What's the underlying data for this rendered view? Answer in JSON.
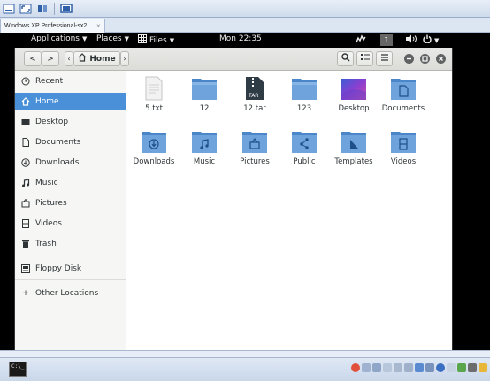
{
  "host": {
    "tab_title": "Windows XP Professional-sx2 ...",
    "tab_close": "×"
  },
  "topbar": {
    "applications": "Applications",
    "places": "Places",
    "files": "Files",
    "clock": "Mon 22:35",
    "workspace": "1"
  },
  "headerbar": {
    "back": "<",
    "forward": ">",
    "path_left": "‹",
    "path_home": "Home",
    "path_right": "›"
  },
  "sidebar": {
    "items": [
      {
        "label": "Recent",
        "icon": "clock-icon"
      },
      {
        "label": "Home",
        "icon": "home-icon",
        "active": true
      },
      {
        "label": "Desktop",
        "icon": "desktop-icon"
      },
      {
        "label": "Documents",
        "icon": "document-icon"
      },
      {
        "label": "Downloads",
        "icon": "download-icon"
      },
      {
        "label": "Music",
        "icon": "music-icon"
      },
      {
        "label": "Pictures",
        "icon": "pictures-icon"
      },
      {
        "label": "Videos",
        "icon": "video-icon"
      },
      {
        "label": "Trash",
        "icon": "trash-icon"
      },
      {
        "label": "Floppy Disk",
        "icon": "floppy-icon"
      },
      {
        "label": "Other Locations",
        "icon": "plus-icon"
      }
    ]
  },
  "files": [
    {
      "name": "5.txt",
      "type": "text"
    },
    {
      "name": "12",
      "type": "folder"
    },
    {
      "name": "12.tar",
      "type": "archive",
      "badge": "TAR"
    },
    {
      "name": "123",
      "type": "folder"
    },
    {
      "name": "Desktop",
      "type": "desktop"
    },
    {
      "name": "Documents",
      "type": "folder-documents"
    },
    {
      "name": "Downloads",
      "type": "folder-downloads"
    },
    {
      "name": "Music",
      "type": "folder-music"
    },
    {
      "name": "Pictures",
      "type": "folder-pictures"
    },
    {
      "name": "Public",
      "type": "folder-public"
    },
    {
      "name": "Templates",
      "type": "folder-templates"
    },
    {
      "name": "Videos",
      "type": "folder-videos"
    }
  ],
  "colors": {
    "accent": "#4a90d9",
    "folder": "#4a86c8",
    "folder_top": "#6fa3dc"
  }
}
